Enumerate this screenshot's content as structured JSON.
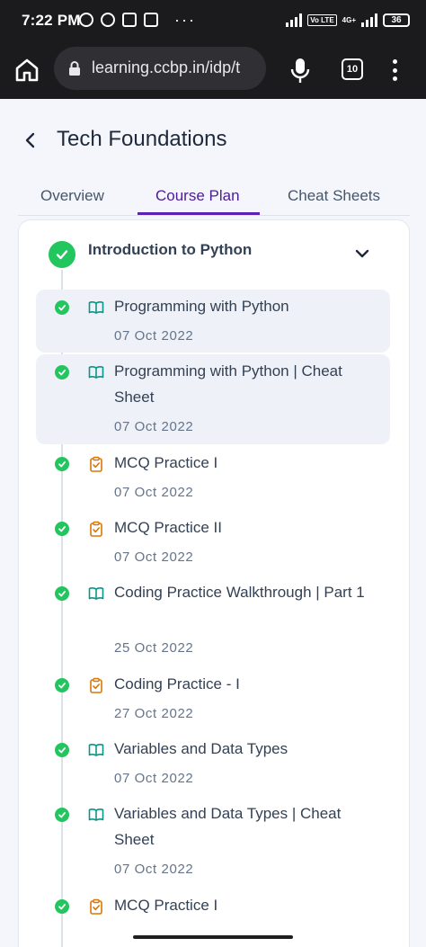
{
  "status_bar": {
    "time": "7:22 PM",
    "volte": "Vo LTE",
    "network": "4G+",
    "battery": "36"
  },
  "browser": {
    "url": "learning.ccbp.in/idp/t",
    "tab_count": "10"
  },
  "header": {
    "title": "Tech Foundations"
  },
  "tabs": [
    {
      "label": "Overview",
      "active": false
    },
    {
      "label": "Course Plan",
      "active": true
    },
    {
      "label": "Cheat Sheets",
      "active": false
    }
  ],
  "module": {
    "title": "Introduction to Python",
    "completed": true
  },
  "items": [
    {
      "title": "Programming with Python",
      "date": "07 Oct 2022",
      "icon": "book-icon",
      "completed": true
    },
    {
      "title": "Programming with Python | Cheat Sheet",
      "date": "07 Oct 2022",
      "icon": "book-icon",
      "completed": true
    },
    {
      "title": "MCQ Practice I",
      "date": "07 Oct 2022",
      "icon": "clipboard-check-icon",
      "completed": true
    },
    {
      "title": "MCQ Practice II",
      "date": "07 Oct 2022",
      "icon": "clipboard-check-icon",
      "completed": true
    },
    {
      "title": "Coding Practice Walkthrough | Part 1",
      "date": "25 Oct 2022",
      "icon": "book-icon",
      "completed": true
    },
    {
      "title": "Coding Practice - I",
      "date": "27 Oct 2022",
      "icon": "clipboard-check-icon",
      "completed": true
    },
    {
      "title": "Variables and Data Types",
      "date": "07 Oct 2022",
      "icon": "book-icon",
      "completed": true
    },
    {
      "title": "Variables and Data Types | Cheat Sheet",
      "date": "07 Oct 2022",
      "icon": "book-icon",
      "completed": true
    },
    {
      "title": "MCQ Practice I",
      "date": "",
      "icon": "clipboard-check-icon",
      "completed": true
    }
  ],
  "colors": {
    "accent": "#5b21b6",
    "complete": "#22c55e",
    "book_icon": "#0d9488",
    "clipboard_icon": "#d97706"
  }
}
